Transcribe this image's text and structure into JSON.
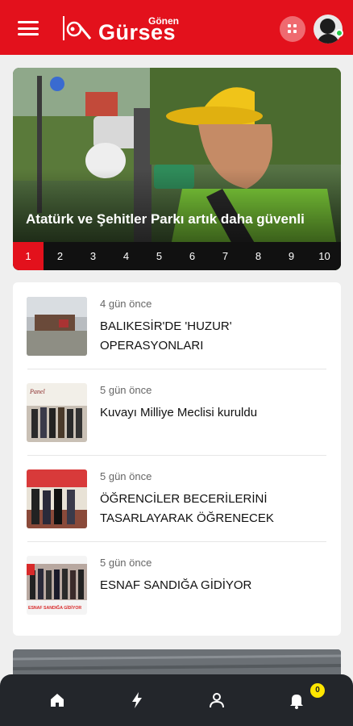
{
  "header": {
    "logo_small": "Gönen",
    "logo_big": "Gürses"
  },
  "hero": {
    "title": "Atatürk ve Şehitler Parkı artık daha güvenli",
    "pages": [
      "1",
      "2",
      "3",
      "4",
      "5",
      "6",
      "7",
      "8",
      "9",
      "10"
    ],
    "active_page": "1"
  },
  "news": [
    {
      "time": "4 gün önce",
      "title": "BALIKESİR'DE 'HUZUR' OPERASYONLARI"
    },
    {
      "time": "5 gün önce",
      "title": "Kuvayı Milliye Meclisi kuruldu"
    },
    {
      "time": "5 gün önce",
      "title": "ÖĞRENCİLER BECERİLERİNİ TASARLAYARAK ÖĞRENECEK"
    },
    {
      "time": "5 gün önce",
      "title": "ESNAF SANDIĞA GİDİYOR"
    }
  ],
  "thumb_texts": {
    "panel": "Panel",
    "esnaf": "ESNAF SANDIĞA GİDİYOR"
  },
  "bottom_nav": {
    "items": [
      "home-icon",
      "flash-icon",
      "user-icon",
      "bell-icon"
    ],
    "badge": "0"
  },
  "colors": {
    "brand_red": "#e3111c",
    "nav_dark": "#23262b",
    "badge_yellow": "#ffe600"
  }
}
